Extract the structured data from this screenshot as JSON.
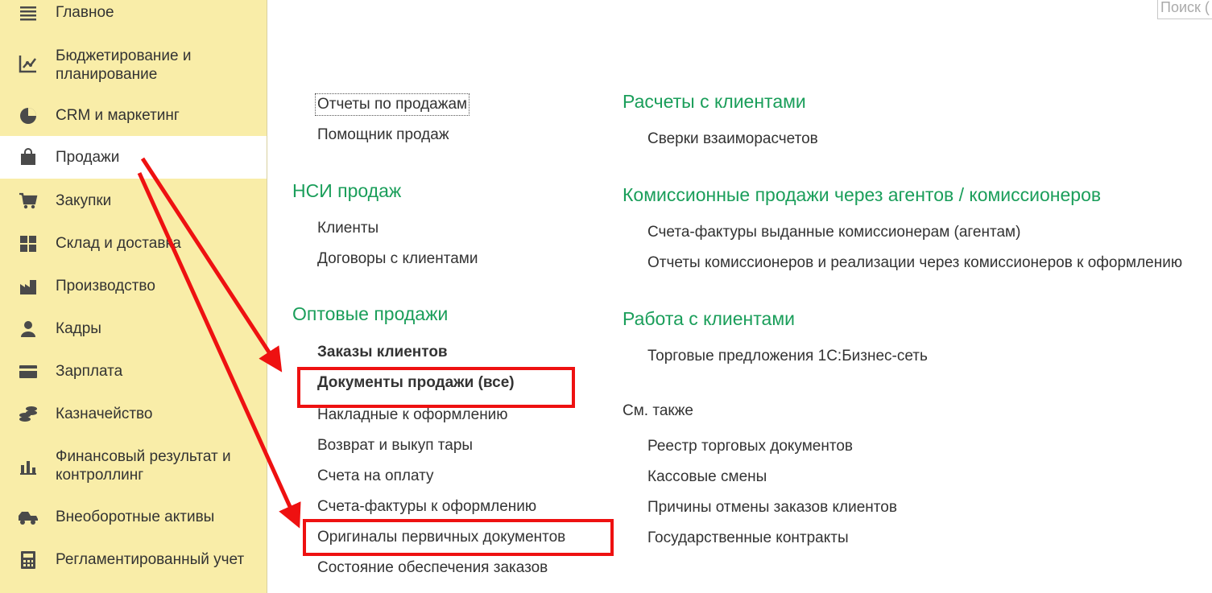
{
  "search": {
    "placeholder": "Поиск ("
  },
  "sidebar": {
    "items": [
      {
        "label": "Главное",
        "icon": "menu-icon"
      },
      {
        "label": "Бюджетирование и\nпланирование",
        "icon": "budget-icon"
      },
      {
        "label": "CRM и маркетинг",
        "icon": "pie-chart-icon"
      },
      {
        "label": "Продажи",
        "icon": "shopping-bag-icon",
        "active": true
      },
      {
        "label": "Закупки",
        "icon": "cart-icon"
      },
      {
        "label": "Склад и доставка",
        "icon": "warehouse-icon"
      },
      {
        "label": "Производство",
        "icon": "factory-icon"
      },
      {
        "label": "Кадры",
        "icon": "person-icon"
      },
      {
        "label": "Зарплата",
        "icon": "card-icon"
      },
      {
        "label": "Казначейство",
        "icon": "coins-icon"
      },
      {
        "label": "Финансовый результат и\nконтроллинг",
        "icon": "bar-chart-icon"
      },
      {
        "label": "Внеоборотные активы",
        "icon": "truck-icon"
      },
      {
        "label": "Регламентированный учет",
        "icon": "calculator-icon"
      }
    ]
  },
  "left_column": {
    "top_links": [
      "Отчеты по продажам",
      "Помощник продаж"
    ],
    "nsi": {
      "title": "НСИ продаж",
      "links": [
        "Клиенты",
        "Договоры с клиентами"
      ]
    },
    "wholesale": {
      "title": "Оптовые продажи",
      "links": [
        "Заказы клиентов",
        "Документы продажи (все)",
        "Накладные к оформлению",
        "Возврат и выкуп тары",
        "Счета на оплату",
        "Счета-фактуры к оформлению",
        "Оригиналы первичных документов",
        "Состояние обеспечения заказов"
      ]
    }
  },
  "right_column": {
    "settlements": {
      "title": "Расчеты с клиентами",
      "links": [
        "Сверки взаиморасчетов"
      ]
    },
    "commission": {
      "title": "Комиссионные продажи через агентов / комиссионеров",
      "links": [
        "Счета-фактуры выданные комиссионерам (агентам)",
        "Отчеты комиссионеров и реализации через комиссионеров к оформлению"
      ]
    },
    "clients_work": {
      "title": "Работа с клиентами",
      "links": [
        "Торговые предложения 1С:Бизнес-сеть"
      ]
    },
    "see_also": {
      "title": "См. также",
      "links": [
        "Реестр торговых документов",
        "Кассовые смены",
        "Причины отмены заказов клиентов",
        "Государственные контракты"
      ]
    }
  },
  "colors": {
    "sidebar_bg": "#f9eda8",
    "section_title": "#1a9e5a",
    "annotation_red": "#ee1111",
    "text": "#333333"
  }
}
